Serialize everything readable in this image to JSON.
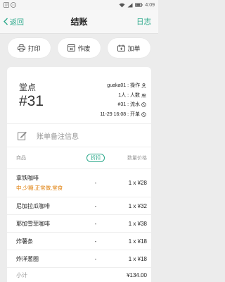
{
  "status_bar": {
    "time": "4:09"
  },
  "header": {
    "back_label": "返回",
    "title": "结账",
    "log_label": "日志"
  },
  "actions": [
    {
      "label": "打印",
      "icon": "printer-icon"
    },
    {
      "label": "作废",
      "icon": "void-icon"
    },
    {
      "label": "加单",
      "icon": "add-order-icon"
    }
  ],
  "table": {
    "label": "堂点",
    "number": "#31",
    "info": [
      {
        "text": "guaka01 : 操作",
        "icon": "person-icon"
      },
      {
        "text": "1人 : 人数",
        "icon": "people-icon"
      },
      {
        "text": "#31 : 流水",
        "icon": "clock-icon"
      },
      {
        "text": "11-29 16:08 : 开单",
        "icon": "clock-icon"
      }
    ]
  },
  "note": {
    "placeholder": "账单备注信息"
  },
  "columns": {
    "name": "商品",
    "discount": "折扣",
    "qty_price": "数量价格"
  },
  "items": [
    {
      "name": "拿铁咖啡",
      "options": "中,少糖,正常做,堂食",
      "discount": "-",
      "qty_price": "1 x ¥28"
    },
    {
      "name": "尼加拉瓜咖啡",
      "options": "",
      "discount": "-",
      "qty_price": "1 x ¥32"
    },
    {
      "name": "耶加雪菲咖啡",
      "options": "",
      "discount": "-",
      "qty_price": "1 x ¥38"
    },
    {
      "name": "炸薯条",
      "options": "",
      "discount": "-",
      "qty_price": "1 x ¥18"
    },
    {
      "name": "炸洋葱圈",
      "options": "",
      "discount": "-",
      "qty_price": "1 x ¥18"
    }
  ],
  "subtotal": {
    "label": "小计",
    "value": "¥134.00"
  },
  "colors": {
    "accent": "#2aa88a",
    "option_text": "#e0810e",
    "background": "#ececec"
  }
}
